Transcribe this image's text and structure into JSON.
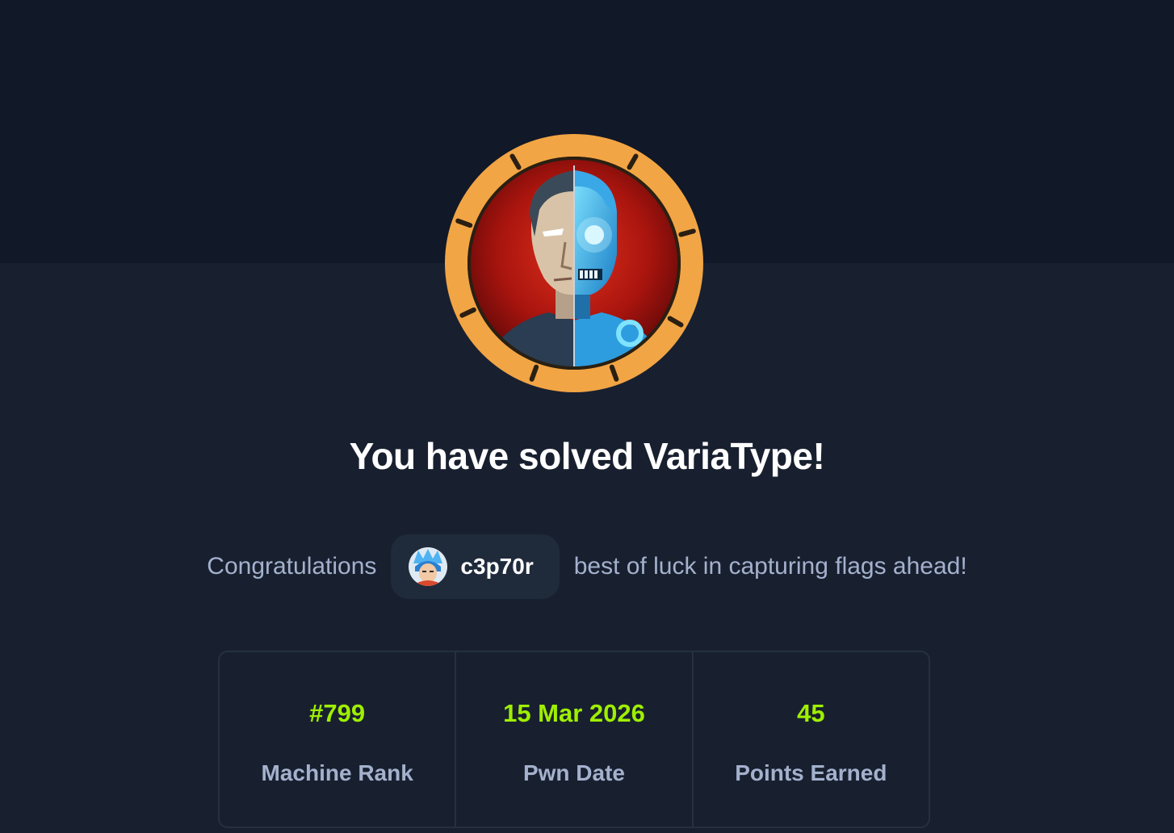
{
  "machine": {
    "name": "VariaType",
    "badge_icon": "machine-avatar-half-human-half-cyborg",
    "ring_color": "#f2a544"
  },
  "title": "You have solved VariaType!",
  "congrats": {
    "prefix": "Congratulations",
    "suffix": "best of luck in capturing flags ahead!",
    "user": {
      "name": "c3p70r",
      "avatar_icon": "user-avatar-icon"
    }
  },
  "stats": [
    {
      "value": "#799",
      "label": "Machine Rank"
    },
    {
      "value": "15 Mar 2026",
      "label": "Pwn Date"
    },
    {
      "value": "45",
      "label": "Points Earned"
    }
  ],
  "colors": {
    "accent_green": "#9fef00",
    "muted_text": "#a4b1cd",
    "background": "#182030",
    "top_band": "#111827"
  }
}
